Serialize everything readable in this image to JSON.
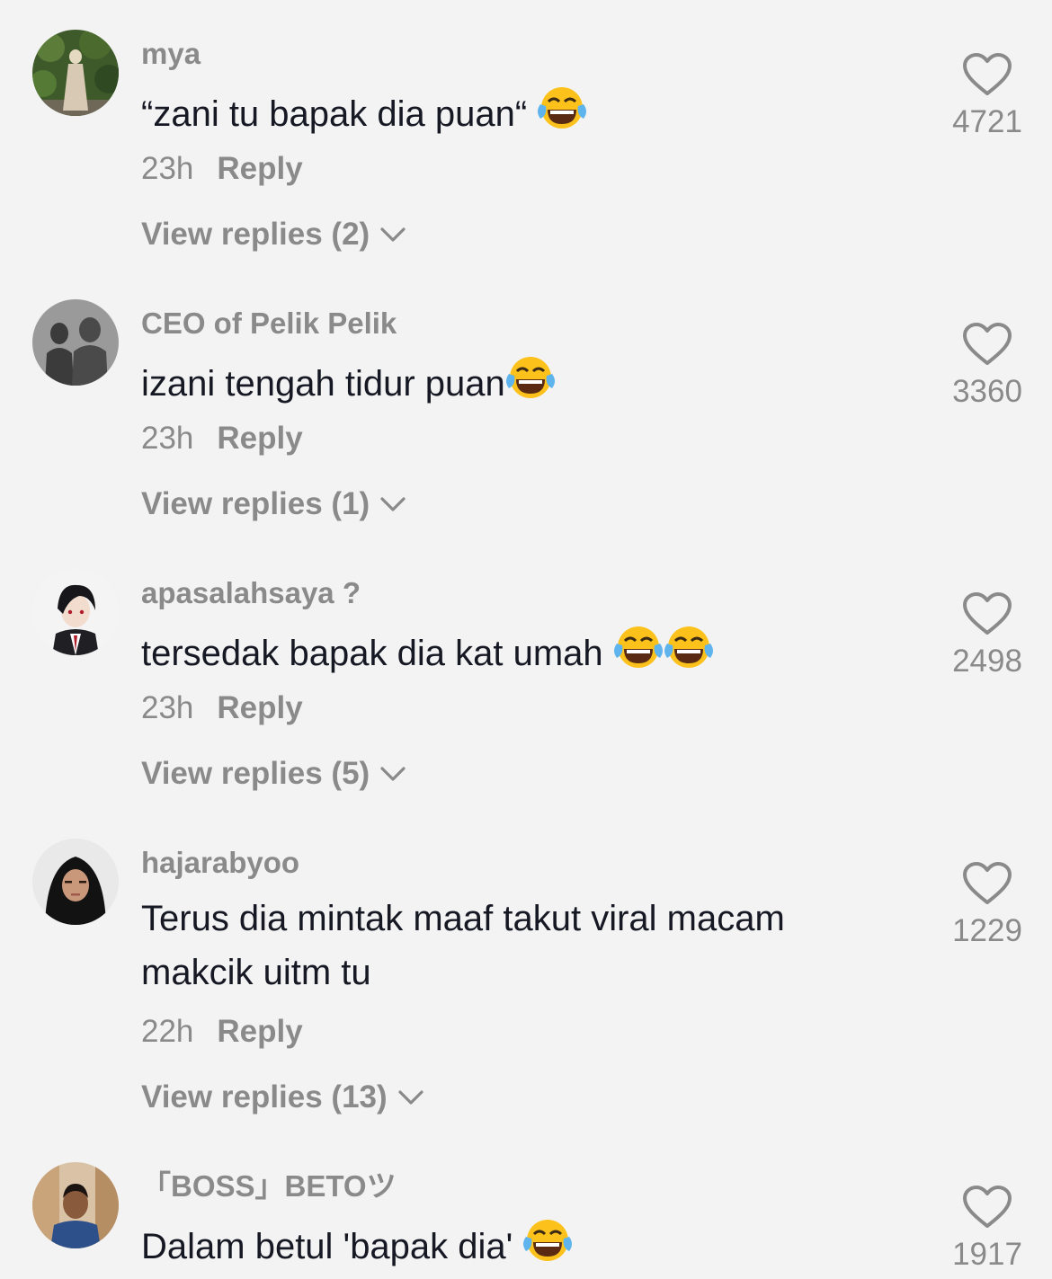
{
  "comments": [
    {
      "username": "mya",
      "text": "“zani tu bapak dia puan“",
      "emoji_count": 1,
      "time": "23h",
      "reply_label": "Reply",
      "view_replies": "View replies (2)",
      "likes": "4721",
      "avatar_icon": "avatar-photo-woman-garden"
    },
    {
      "username": "CEO of Pelik Pelik",
      "text": "izani tengah tidur puan",
      "emoji_count": 1,
      "time": "23h",
      "reply_label": "Reply",
      "view_replies": "View replies (1)",
      "likes": "3360",
      "avatar_icon": "avatar-photo-silhouettes"
    },
    {
      "username": "apasalahsaya ?",
      "text": "tersedak bapak dia kat umah",
      "emoji_count": 2,
      "time": "23h",
      "reply_label": "Reply",
      "view_replies": "View replies (5)",
      "likes": "2498",
      "avatar_icon": "avatar-anime-character"
    },
    {
      "username": "hajarabyoo",
      "text_line1": "Terus dia mintak maaf takut viral macam",
      "text_line2": "makcik uitm tu",
      "emoji_count": 0,
      "time": "22h",
      "reply_label": "Reply",
      "view_replies": "View replies (13)",
      "likes": "1229",
      "avatar_icon": "avatar-photo-woman-hijab"
    },
    {
      "username": "「BOSS」BETOツ",
      "text": "Dalam betul 'bapak dia'",
      "emoji_count": 1,
      "likes": "1917",
      "avatar_icon": "avatar-photo-man"
    }
  ],
  "colors": {
    "background": "#f3f3f3",
    "secondary_text": "#8a8a8a",
    "primary_text": "#161823"
  },
  "emoji_name": "face-with-tears-of-joy",
  "like_icon": "heart-outline-icon",
  "expand_icon": "chevron-down-icon"
}
